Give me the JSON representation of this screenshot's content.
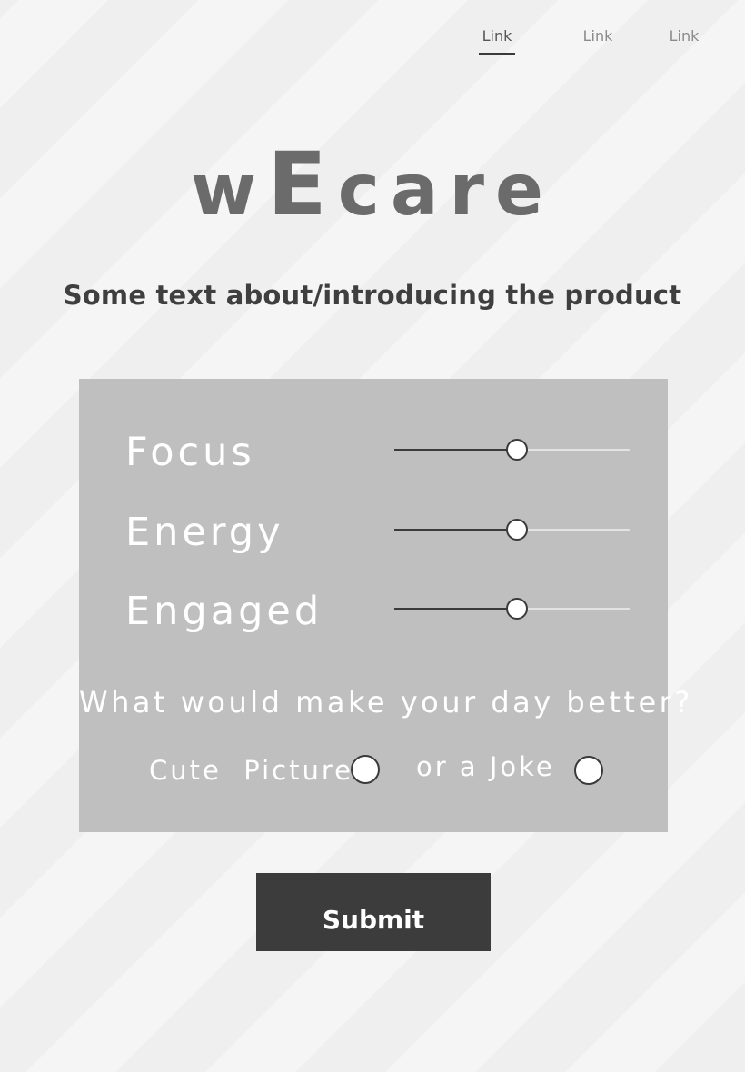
{
  "nav": {
    "links": [
      {
        "label": "Link",
        "active": true
      },
      {
        "label": "Link",
        "active": false
      },
      {
        "label": "Link",
        "active": false
      }
    ]
  },
  "logo": {
    "part1": "w",
    "part2": "E",
    "part3": "care"
  },
  "tagline": "Some text about/introducing the product",
  "metrics": [
    {
      "label": "Focus",
      "level": 0.52
    },
    {
      "label": "Energy",
      "level": 0.52
    },
    {
      "label": "Engaged",
      "level": 0.52
    }
  ],
  "question": "What would make your day better?",
  "choices": {
    "picture_label": "Cute  Picture",
    "joke_label": "or a Joke"
  },
  "submit_label": "Submit",
  "colors": {
    "panel": "#bfbfbf",
    "button": "#3c3c3c",
    "logo": "#6b6b6b"
  }
}
